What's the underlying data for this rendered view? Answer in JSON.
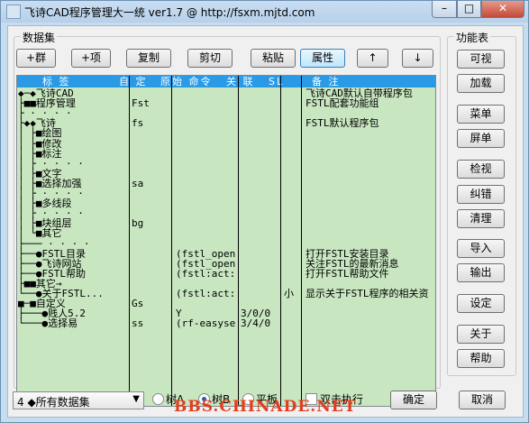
{
  "title": "飞诗CAD程序管理大一统 ver1.7 @ http://fsxm.mjtd.com",
  "window_buttons": {
    "minimize": "–",
    "maximize": "□",
    "close": "✕"
  },
  "groups": {
    "dataset": "数据集",
    "functions": "功能表"
  },
  "toolbar": [
    {
      "name": "add-group-button",
      "label": "+群"
    },
    {
      "name": "add-item-button",
      "label": "+项"
    },
    {
      "name": "copy-button",
      "label": "复制"
    },
    {
      "name": "cut-button",
      "label": "剪切"
    },
    {
      "name": "paste-button",
      "label": "粘贴"
    },
    {
      "name": "properties-button",
      "label": "属性"
    },
    {
      "name": "move-up-button",
      "label": "↑"
    },
    {
      "name": "move-down-button",
      "label": "↓"
    }
  ],
  "functions": [
    {
      "name": "visible-button",
      "label": "可视"
    },
    {
      "name": "load-button",
      "label": "加载"
    },
    {
      "name": "menu-button",
      "label": "菜单"
    },
    {
      "name": "screen-menu-button",
      "label": "屏单"
    },
    {
      "name": "inspect-button",
      "label": "检视"
    },
    {
      "name": "fix-errors-button",
      "label": "纠错"
    },
    {
      "name": "clean-button",
      "label": "清理"
    },
    {
      "name": "import-button",
      "label": "导入"
    },
    {
      "name": "export-button",
      "label": "输出"
    },
    {
      "name": "settings-button",
      "label": "设定"
    },
    {
      "name": "about-button",
      "label": "关于"
    },
    {
      "name": "help-button",
      "label": "帮助"
    }
  ],
  "columns": [
    "标 签",
    "自 定",
    "原始 命令",
    "关 联",
    "SL",
    "备 注"
  ],
  "rows": [
    {
      "tree": "◆─◆飞诗CAD",
      "custom": "",
      "cmd": "",
      "link": "",
      "sl": "",
      "note": "飞诗CAD默认自带程序包"
    },
    {
      "tree": " ├■■程序管理",
      "custom": "Fst",
      "cmd": "",
      "link": "",
      "sl": "",
      "note": "FSTL配套功能组"
    },
    {
      "tree": " ├  · · · ·",
      "custom": "",
      "cmd": "",
      "link": "",
      "sl": "",
      "note": ""
    },
    {
      "tree": " ├◆◆飞诗",
      "custom": "fs",
      "cmd": "",
      "link": "",
      "sl": "",
      "note": "FSTL默认程序包"
    },
    {
      "tree": " │ ├■绘图",
      "custom": "",
      "cmd": "",
      "link": "",
      "sl": "",
      "note": ""
    },
    {
      "tree": " │ ├■修改",
      "custom": "",
      "cmd": "",
      "link": "",
      "sl": "",
      "note": ""
    },
    {
      "tree": " │ ├■标注",
      "custom": "",
      "cmd": "",
      "link": "",
      "sl": "",
      "note": ""
    },
    {
      "tree": " │ ├ · · · ·",
      "custom": "",
      "cmd": "",
      "link": "",
      "sl": "",
      "note": ""
    },
    {
      "tree": " │ ├■文字",
      "custom": "",
      "cmd": "",
      "link": "",
      "sl": "",
      "note": ""
    },
    {
      "tree": " │ ├■选择加强",
      "custom": "sa",
      "cmd": "",
      "link": "",
      "sl": "",
      "note": ""
    },
    {
      "tree": " │ ├ · · · ·",
      "custom": "",
      "cmd": "",
      "link": "",
      "sl": "",
      "note": ""
    },
    {
      "tree": " │ ├■多线段",
      "custom": "",
      "cmd": "",
      "link": "",
      "sl": "",
      "note": ""
    },
    {
      "tree": " │ ├ · · · ·",
      "custom": "",
      "cmd": "",
      "link": "",
      "sl": "",
      "note": ""
    },
    {
      "tree": " │ ├■块组层",
      "custom": "bg",
      "cmd": "",
      "link": "",
      "sl": "",
      "note": ""
    },
    {
      "tree": " │ └■其它",
      "custom": "",
      "cmd": "",
      "link": "",
      "sl": "",
      "note": ""
    },
    {
      "tree": " ├─── · · · ·",
      "custom": "",
      "cmd": "",
      "link": "",
      "sl": "",
      "note": ""
    },
    {
      "tree": " ├──●FSTL目录",
      "custom": "",
      "cmd": "(fstl_open",
      "link": "",
      "sl": "",
      "note": "打开FSTL安装目录"
    },
    {
      "tree": " ├──●飞诗网站",
      "custom": "",
      "cmd": "(fstl_open",
      "link": "",
      "sl": "",
      "note": "关注FSTL的最新消息"
    },
    {
      "tree": " ├──●FSTL帮助",
      "custom": "",
      "cmd": "(fstl:act:",
      "link": "",
      "sl": "",
      "note": "打开FSTL帮助文件"
    },
    {
      "tree": " ├■■其它→",
      "custom": "",
      "cmd": "",
      "link": "",
      "sl": "",
      "note": ""
    },
    {
      "tree": " └──●关于FSTL...",
      "custom": "",
      "cmd": "(fstl:act:",
      "link": "",
      "sl": "小",
      "note": "显示关于FSTL程序的相关资"
    },
    {
      "tree": "■─■自定义",
      "custom": "Gs",
      "cmd": "",
      "link": "",
      "sl": "",
      "note": ""
    },
    {
      "tree": "├───●贱人5.2",
      "custom": "",
      "cmd": "Y",
      "link": "3/0/0",
      "sl": "",
      "note": ""
    },
    {
      "tree": "└───●选择易",
      "custom": "ss",
      "cmd": "(rf-easyse",
      "link": "3/4/0",
      "sl": "",
      "note": ""
    }
  ],
  "dataset_select": {
    "value": "4 ◆所有数据集"
  },
  "radios": [
    {
      "name": "radio-tree-a",
      "label": "树A",
      "checked": false
    },
    {
      "name": "radio-tree-b",
      "label": "树B",
      "checked": true
    },
    {
      "name": "radio-flat",
      "label": "平板",
      "checked": false
    }
  ],
  "double_click": {
    "label": "双击执行",
    "checked": false
  },
  "ok_label": "确定",
  "cancel_label": "取消",
  "watermark": "BBS.CHINADE.NET"
}
